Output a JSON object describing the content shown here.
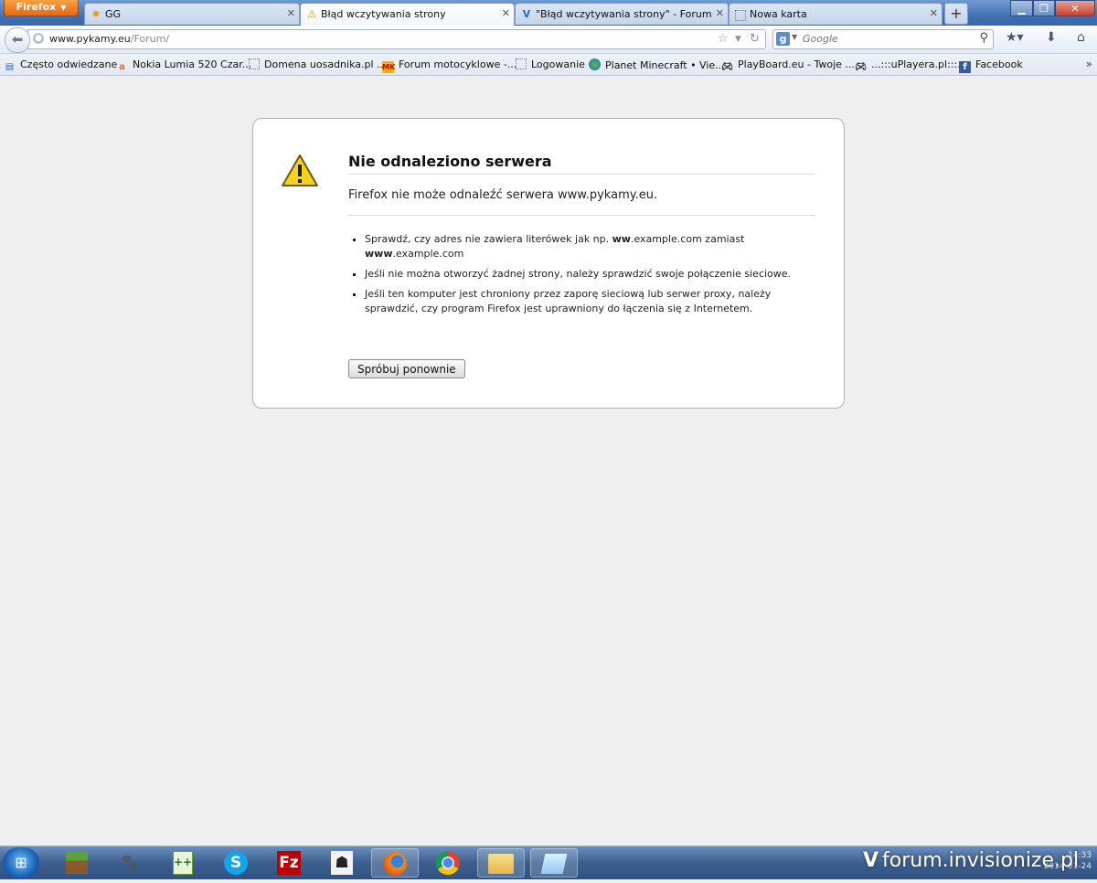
{
  "browser": {
    "menu_label": "Firefox",
    "tabs": [
      {
        "label": "GG",
        "icon": "sun-icon"
      },
      {
        "label": "Błąd wczytywania strony",
        "icon": "warning-icon"
      },
      {
        "label": "\"Błąd wczytywania strony\" - Forum P...",
        "icon": "forum-icon"
      },
      {
        "label": "Nowa karta",
        "icon": "blank-page-icon"
      }
    ],
    "newtab_label": "+",
    "url": {
      "host": "www.pykamy.eu",
      "path": "/Forum/"
    },
    "search": {
      "engine": "g",
      "placeholder": "Google"
    }
  },
  "bookmarks": [
    {
      "label": "Często odwiedzane",
      "icon": "folder-icon"
    },
    {
      "label": "Nokia Lumia 520 Czar...",
      "icon": "allegro-icon"
    },
    {
      "label": "Domena uosadnika.pl ...",
      "icon": "blank-page-icon"
    },
    {
      "label": "Forum motocyklowe -...",
      "icon": "mk-icon"
    },
    {
      "label": "Logowanie",
      "icon": "blank-page-icon"
    },
    {
      "label": "Planet Minecraft • Vie...",
      "icon": "globe-icon"
    },
    {
      "label": "PlayBoard.eu - Twoje ...",
      "icon": "gamepad-icon"
    },
    {
      "label": "...:::uPlayera.pl:::...",
      "icon": "gamepad-icon"
    },
    {
      "label": "Facebook",
      "icon": "facebook-icon"
    }
  ],
  "error": {
    "title": "Nie odnaleziono serwera",
    "short": "Firefox nie może odnaleźć serwera www.pykamy.eu.",
    "items": {
      "item1_pre": "Sprawdź, czy adres nie zawiera literówek jak np. ",
      "item1_b1": "ww",
      "item1_mid": ".example.com zamiast ",
      "item1_b2": "www",
      "item1_post": ".example.com",
      "item2": "Jeśli nie można otworzyć żadnej strony, należy sprawdzić swoje połączenie sieciowe.",
      "item3": "Jeśli ten komputer jest chroniony przez zaporę sieciową lub serwer proxy, należy sprawdzić, czy program Firefox jest uprawniony do łączenia się z Internetem."
    },
    "retry_label": "Spróbuj ponownie"
  },
  "taskbar": {
    "apps": [
      "minecraft-icon",
      "gimp-icon",
      "notepad-plus-icon",
      "skype-icon",
      "filezilla-icon",
      "counter-strike-icon",
      "firefox-icon",
      "chrome-icon",
      "explorer-icon",
      "sticky-notes-icon"
    ],
    "clock_time": "14:33",
    "clock_date": "2014-01-24"
  },
  "watermark": "forum.invisionize.pl",
  "colors": {
    "titlebar": "#3d6db0",
    "firefox_orange": "#e46a10",
    "page_bg": "#efefef"
  }
}
